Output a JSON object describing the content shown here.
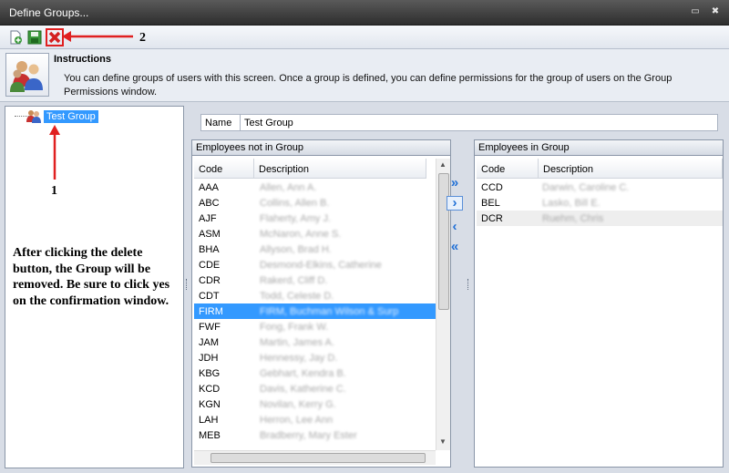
{
  "window": {
    "title": "Define Groups..."
  },
  "title_buttons": {
    "restore": "▭",
    "close": "✖"
  },
  "toolbar": {
    "new_icon": "new-document-icon",
    "save_icon": "save-icon",
    "delete_icon": "delete-icon"
  },
  "instructions": {
    "heading": "Instructions",
    "text": "You can define groups of users with this screen.  Once a group is defined, you can define permissions for the group of users on the Group Permissions window."
  },
  "tree": {
    "items": [
      {
        "label": "Test Group"
      }
    ]
  },
  "annotation": {
    "note": "After clicking the delete button, the Group will be removed.  Be sure to click yes on the confirmation window.",
    "number1": "1",
    "number2": "2",
    "arrow_color": "#e02020"
  },
  "group": {
    "name_label": "Name",
    "name_value": "Test Group"
  },
  "not_in_group": {
    "title": "Employees not in Group",
    "columns": [
      "Code",
      "Description"
    ],
    "rows": [
      {
        "code": "AAA",
        "desc": "Allen, Ann A."
      },
      {
        "code": "ABC",
        "desc": "Collins, Allen B."
      },
      {
        "code": "AJF",
        "desc": "Flaherty, Amy J."
      },
      {
        "code": "ASM",
        "desc": "McNaron, Anne S."
      },
      {
        "code": "BHA",
        "desc": "Allyson, Brad H."
      },
      {
        "code": "CDE",
        "desc": "Desmond-Elkins, Catherine"
      },
      {
        "code": "CDR",
        "desc": "Rakerd, Cliff D."
      },
      {
        "code": "CDT",
        "desc": "Todd, Celeste D."
      },
      {
        "code": "FIRM",
        "desc": "FIRM, Buchman Wilson & Surp"
      },
      {
        "code": "FWF",
        "desc": "Fong, Frank W."
      },
      {
        "code": "JAM",
        "desc": "Martin, James A."
      },
      {
        "code": "JDH",
        "desc": "Hennessy, Jay D."
      },
      {
        "code": "KBG",
        "desc": "Gebhart, Kendra B."
      },
      {
        "code": "KCD",
        "desc": "Davis, Katherine C."
      },
      {
        "code": "KGN",
        "desc": "Novilan, Kerry G."
      },
      {
        "code": "LAH",
        "desc": "Herron, Lee Ann"
      },
      {
        "code": "MEB",
        "desc": "Bradberry, Mary Ester"
      }
    ],
    "selected_index": 8
  },
  "in_group": {
    "title": "Employees in Group",
    "columns": [
      "Code",
      "Description"
    ],
    "rows": [
      {
        "code": "CCD",
        "desc": "Darwin, Caroline C."
      },
      {
        "code": "BEL",
        "desc": "Lasko, Bill E."
      },
      {
        "code": "DCR",
        "desc": "Ruehm, Chris"
      }
    ]
  },
  "movers": {
    "add_all": "»",
    "add": "›",
    "remove": "‹",
    "remove_all": "«"
  },
  "colors": {
    "selection": "#3399ff",
    "accent": "#1f6fd6"
  }
}
